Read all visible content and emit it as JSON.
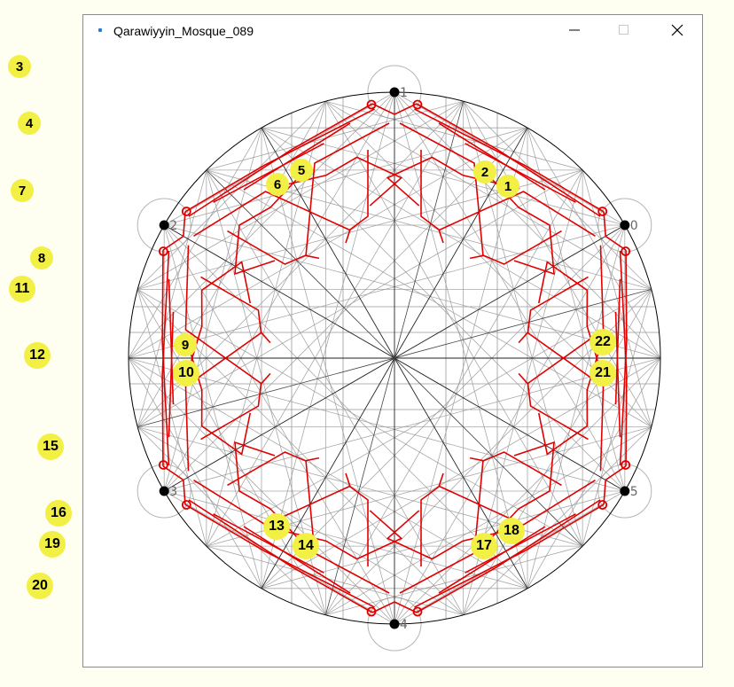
{
  "window": {
    "title": "Qarawiyyin_Mosque_089",
    "controls": [
      "minimize",
      "maximize",
      "close"
    ]
  },
  "outer_markers": [
    "3",
    "4",
    "7",
    "8",
    "11",
    "12",
    "15",
    "16",
    "19",
    "20"
  ],
  "canvas_markers": [
    "1",
    "2",
    "5",
    "6",
    "9",
    "10",
    "13",
    "14",
    "17",
    "18",
    "21",
    "22"
  ],
  "vertex_labels": [
    "0",
    "1",
    "2",
    "3",
    "4",
    "5"
  ],
  "colors": {
    "background": "#fefff0",
    "marker": "#f2ef45",
    "pattern": "#e00000",
    "construction": "#999999",
    "circle": "#000000"
  }
}
